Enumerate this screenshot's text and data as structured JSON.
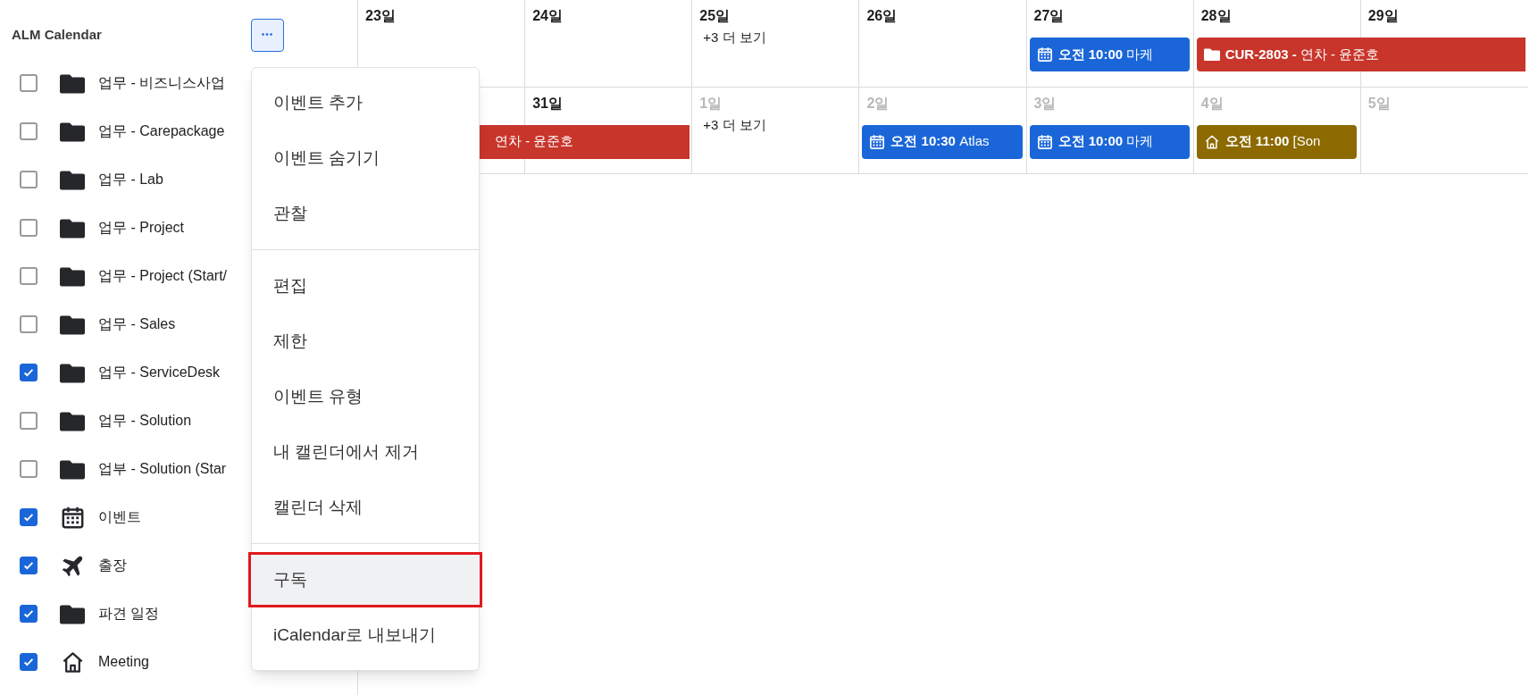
{
  "sidebar": {
    "title": "ALM Calendar",
    "more_button": "•••",
    "items": [
      {
        "label": "업무 - 비즈니스사업",
        "kind": "folder",
        "checked": false
      },
      {
        "label": "업무 - Carepackage",
        "kind": "folder",
        "checked": false
      },
      {
        "label": "업무 - Lab",
        "kind": "folder",
        "checked": false
      },
      {
        "label": "업무 - Project",
        "kind": "folder",
        "checked": false
      },
      {
        "label": "업무 - Project (Start/",
        "kind": "folder",
        "checked": false
      },
      {
        "label": "업무 - Sales",
        "kind": "folder",
        "checked": false
      },
      {
        "label": "업무 - ServiceDesk",
        "kind": "folder",
        "checked": true
      },
      {
        "label": "업무 - Solution",
        "kind": "folder",
        "checked": false
      },
      {
        "label": "업부 - Solution (Star",
        "kind": "folder",
        "checked": false
      },
      {
        "label": "이벤트",
        "kind": "calendar",
        "checked": true
      },
      {
        "label": "출장",
        "kind": "plane",
        "checked": true
      },
      {
        "label": "파견 일정",
        "kind": "folder",
        "checked": true
      },
      {
        "label": "Meeting",
        "kind": "house",
        "checked": true
      }
    ]
  },
  "menu": {
    "groups": [
      {
        "items": [
          {
            "label": "이벤트 추가",
            "selected": false
          },
          {
            "label": "이벤트 숨기기",
            "selected": false
          },
          {
            "label": "관찰",
            "selected": false
          }
        ]
      },
      {
        "items": [
          {
            "label": "편집",
            "selected": false
          },
          {
            "label": "제한",
            "selected": false
          },
          {
            "label": "이벤트 유형",
            "selected": false
          },
          {
            "label": "내 캘린더에서 제거",
            "selected": false
          },
          {
            "label": "캘린더 삭제",
            "selected": false
          }
        ]
      },
      {
        "items": [
          {
            "label": "구독",
            "selected": true
          },
          {
            "label": "iCalendar로 내보내기",
            "selected": false
          }
        ]
      }
    ]
  },
  "weeks": [
    {
      "days": [
        {
          "label": "23일",
          "dimmed": false
        },
        {
          "label": "24일",
          "dimmed": false
        },
        {
          "label": "25일",
          "dimmed": false,
          "more": "+3 더 보기"
        },
        {
          "label": "26일",
          "dimmed": false
        },
        {
          "label": "27일",
          "dimmed": false,
          "events": [
            {
              "kind": "event",
              "time": "오전 10:00",
              "title": "마케",
              "color": "#1a66d8",
              "continues": false
            }
          ]
        },
        {
          "label": "28일",
          "dimmed": false,
          "events": [
            {
              "kind": "leave",
              "title": "**CUR-2803 -** 연차 - 윤준호",
              "color": "#c8352b",
              "continues": true
            }
          ]
        },
        {
          "label": "29일",
          "dimmed": false
        }
      ]
    },
    {
      "days": [
        {
          "events": [
            {
              "kind": "leave",
              "title": "연차 - 윤준호",
              "color": "#c8352b",
              "continues": true
            }
          ]
        },
        {
          "label": "31일",
          "dimmed": false
        },
        {
          "label": "1일",
          "dimmed": true,
          "more": "+3 더 보기"
        },
        {
          "label": "2일",
          "dimmed": true,
          "events": [
            {
              "kind": "event",
              "time": "오전 10:30",
              "title": "Atlas",
              "color": "#1a66d8",
              "continues": false
            }
          ]
        },
        {
          "label": "3일",
          "dimmed": true,
          "events": [
            {
              "kind": "event",
              "time": "오전 10:00",
              "title": "마케",
              "color": "#1a66d8",
              "continues": false
            }
          ]
        },
        {
          "label": "4일",
          "dimmed": true,
          "events": [
            {
              "kind": "meeting",
              "time": "오전 11:00",
              "title": "[Son",
              "color": "#8c6a00",
              "continues": false
            }
          ]
        },
        {
          "label": "5일",
          "dimmed": true
        }
      ]
    }
  ]
}
